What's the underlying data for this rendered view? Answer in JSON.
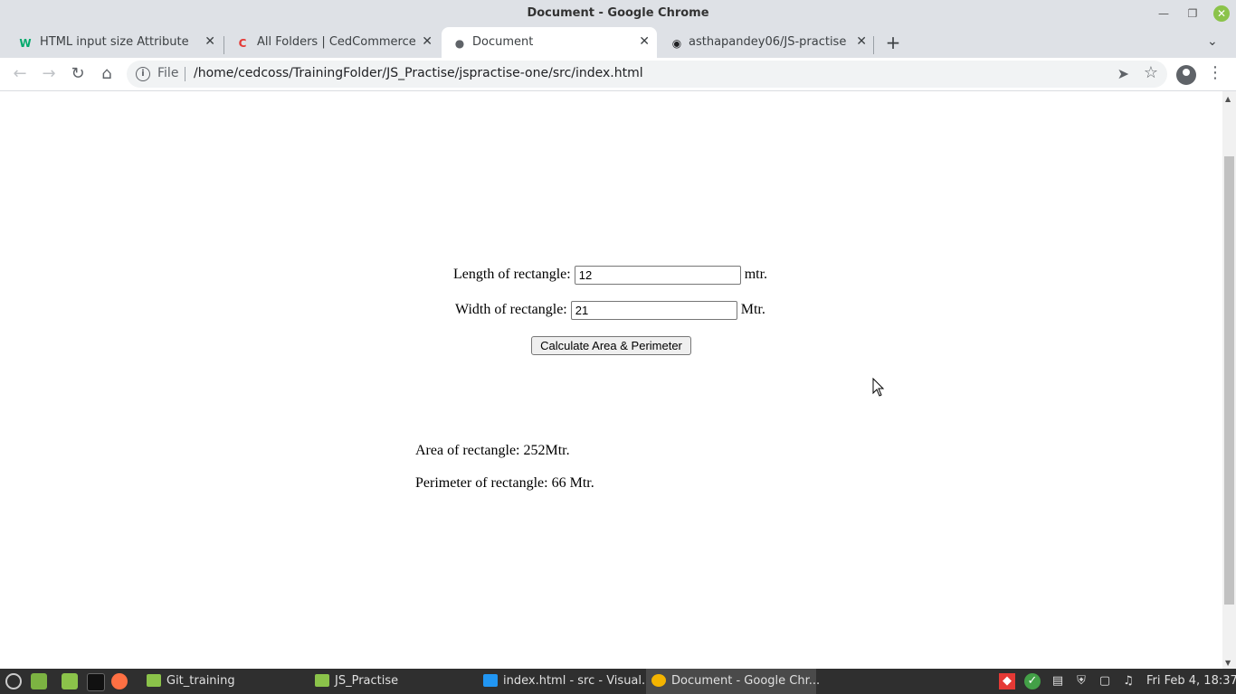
{
  "window": {
    "title": "Document - Google Chrome"
  },
  "tabs": [
    {
      "label": "HTML input size Attribute",
      "icon": "w3schools-icon",
      "active": false
    },
    {
      "label": "All Folders | CedCommerce (L",
      "icon": "cedcommerce-icon",
      "active": false
    },
    {
      "label": "Document",
      "icon": "globe-icon",
      "active": true
    },
    {
      "label": "asthapandey06/JS-practise",
      "icon": "github-icon",
      "active": false
    }
  ],
  "toolbar": {
    "scheme": "File",
    "url": "/home/cedcoss/TrainingFolder/JS_Practise/jspractise-one/src/index.html"
  },
  "page": {
    "length_label": "Length of rectangle:",
    "length_value": "12",
    "length_unit": "mtr.",
    "width_label": "Width of rectangle:",
    "width_value": "21",
    "width_unit": "Mtr.",
    "button_label": "Calculate Area & Perimeter",
    "area_text": "Area of rectangle: 252Mtr.",
    "perimeter_text": "Perimeter of rectangle: 66 Mtr."
  },
  "taskbar": {
    "items": [
      {
        "label": "Git_training",
        "icon": "folder-icon"
      },
      {
        "label": "JS_Practise",
        "icon": "folder-icon"
      },
      {
        "label": "index.html - src - Visual...",
        "icon": "vscode-icon"
      },
      {
        "label": "Document - Google Chr...",
        "icon": "chrome-icon"
      }
    ],
    "clock": "Fri Feb  4, 18:37"
  }
}
